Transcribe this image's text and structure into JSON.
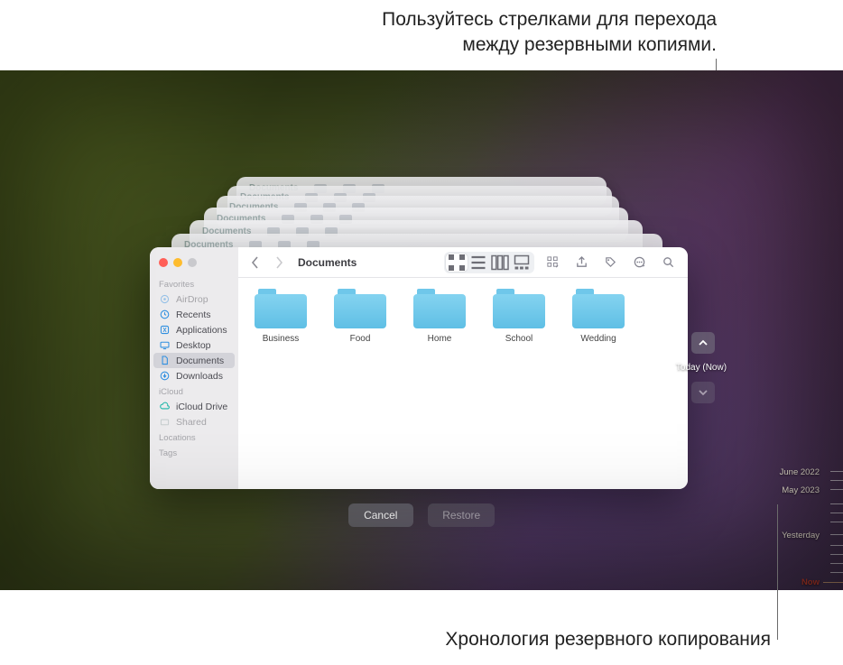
{
  "annotations": {
    "top_line1": "Пользуйтесь стрелками для перехода",
    "top_line2": "между резервными копиями.",
    "bottom": "Хронология резервного копирования"
  },
  "finder": {
    "title": "Documents",
    "sidebar": {
      "favorites_head": "Favorites",
      "items": [
        {
          "label": "AirDrop"
        },
        {
          "label": "Recents"
        },
        {
          "label": "Applications"
        },
        {
          "label": "Desktop"
        },
        {
          "label": "Documents"
        },
        {
          "label": "Downloads"
        }
      ],
      "icloud_head": "iCloud",
      "icloud_items": [
        {
          "label": "iCloud Drive"
        },
        {
          "label": "Shared"
        }
      ],
      "locations_head": "Locations",
      "tags_head": "Tags"
    },
    "folders": [
      {
        "name": "Business"
      },
      {
        "name": "Food"
      },
      {
        "name": "Home"
      },
      {
        "name": "School"
      },
      {
        "name": "Wedding"
      }
    ]
  },
  "actions": {
    "cancel": "Cancel",
    "restore": "Restore"
  },
  "tm": {
    "now": "Today (Now)"
  },
  "timeline": {
    "labels": [
      "June 2022",
      "May 2023",
      "Yesterday",
      "Now"
    ]
  }
}
